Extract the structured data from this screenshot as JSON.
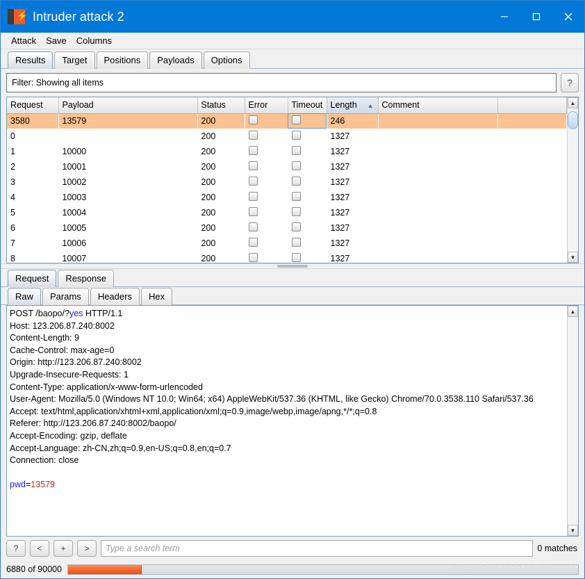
{
  "window": {
    "title": "Intruder attack 2",
    "icon": "burp-suite-icon",
    "controls": {
      "minimize": "minimize-icon",
      "maximize": "maximize-icon",
      "close": "close-icon"
    }
  },
  "menubar": {
    "items": [
      "Attack",
      "Save",
      "Columns"
    ]
  },
  "tabs": {
    "items": [
      "Results",
      "Target",
      "Positions",
      "Payloads",
      "Options"
    ],
    "active": "Results"
  },
  "filter": {
    "text": "Filter: Showing all items",
    "help_label": "?"
  },
  "table": {
    "columns": [
      "Request",
      "Payload",
      "Status",
      "Error",
      "Timeout",
      "Length",
      "Comment"
    ],
    "sorted_column": "Length",
    "sort_direction": "ascending",
    "sort_arrow": "▲",
    "rows": [
      {
        "request": "3580",
        "payload": "13579",
        "status": "200",
        "error": false,
        "timeout": false,
        "length": "246",
        "comment": "",
        "selected": true
      },
      {
        "request": "0",
        "payload": "",
        "status": "200",
        "error": false,
        "timeout": false,
        "length": "1327",
        "comment": "",
        "selected": false
      },
      {
        "request": "1",
        "payload": "10000",
        "status": "200",
        "error": false,
        "timeout": false,
        "length": "1327",
        "comment": "",
        "selected": false
      },
      {
        "request": "2",
        "payload": "10001",
        "status": "200",
        "error": false,
        "timeout": false,
        "length": "1327",
        "comment": "",
        "selected": false
      },
      {
        "request": "3",
        "payload": "10002",
        "status": "200",
        "error": false,
        "timeout": false,
        "length": "1327",
        "comment": "",
        "selected": false
      },
      {
        "request": "4",
        "payload": "10003",
        "status": "200",
        "error": false,
        "timeout": false,
        "length": "1327",
        "comment": "",
        "selected": false
      },
      {
        "request": "5",
        "payload": "10004",
        "status": "200",
        "error": false,
        "timeout": false,
        "length": "1327",
        "comment": "",
        "selected": false
      },
      {
        "request": "6",
        "payload": "10005",
        "status": "200",
        "error": false,
        "timeout": false,
        "length": "1327",
        "comment": "",
        "selected": false
      },
      {
        "request": "7",
        "payload": "10006",
        "status": "200",
        "error": false,
        "timeout": false,
        "length": "1327",
        "comment": "",
        "selected": false
      },
      {
        "request": "8",
        "payload": "10007",
        "status": "200",
        "error": false,
        "timeout": false,
        "length": "1327",
        "comment": "",
        "selected": false
      }
    ]
  },
  "message_tabs": {
    "items": [
      "Request",
      "Response"
    ],
    "active": "Request"
  },
  "view_tabs": {
    "items": [
      "Raw",
      "Params",
      "Headers",
      "Hex"
    ],
    "active": "Raw"
  },
  "request": {
    "request_line_pre": "POST /baopo/?",
    "request_line_param": "yes",
    "request_line_post": " HTTP/1.1",
    "headers": [
      "Host: 123.206.87.240:8002",
      "Content-Length: 9",
      "Cache-Control: max-age=0",
      "Origin: http://123.206.87.240:8002",
      "Upgrade-Insecure-Requests: 1",
      "Content-Type: application/x-www-form-urlencoded",
      "User-Agent: Mozilla/5.0 (Windows NT 10.0; Win64; x64) AppleWebKit/537.36 (KHTML, like Gecko) Chrome/70.0.3538.110 Safari/537.36",
      "Accept: text/html,application/xhtml+xml,application/xml;q=0.9,image/webp,image/apng,*/*;q=0.8",
      "Referer: http://123.206.87.240:8002/baopo/",
      "Accept-Encoding: gzip, deflate",
      "Accept-Language: zh-CN,zh;q=0.9,en-US;q=0.8,en;q=0.7",
      "Connection: close"
    ],
    "body_key": "pwd",
    "body_equals": "=",
    "body_value": "13579"
  },
  "search": {
    "help_label": "?",
    "prev_label": "<",
    "add_label": "+",
    "next_label": ">",
    "placeholder": "Type a search term",
    "value": "",
    "matches": "0 matches"
  },
  "status": {
    "progress_text": "6880 of 90000",
    "progress_current": 6880,
    "progress_total": 90000,
    "progress_percent": 14.5,
    "watermark": "https://blog.csdn.net/wssmiss"
  },
  "colors": {
    "titlebar": "#0078d7",
    "selected_row": "#fcc291",
    "progress_fill": "#f04b14",
    "param_blue": "#1a1ae6",
    "value_red": "#c0281e"
  }
}
